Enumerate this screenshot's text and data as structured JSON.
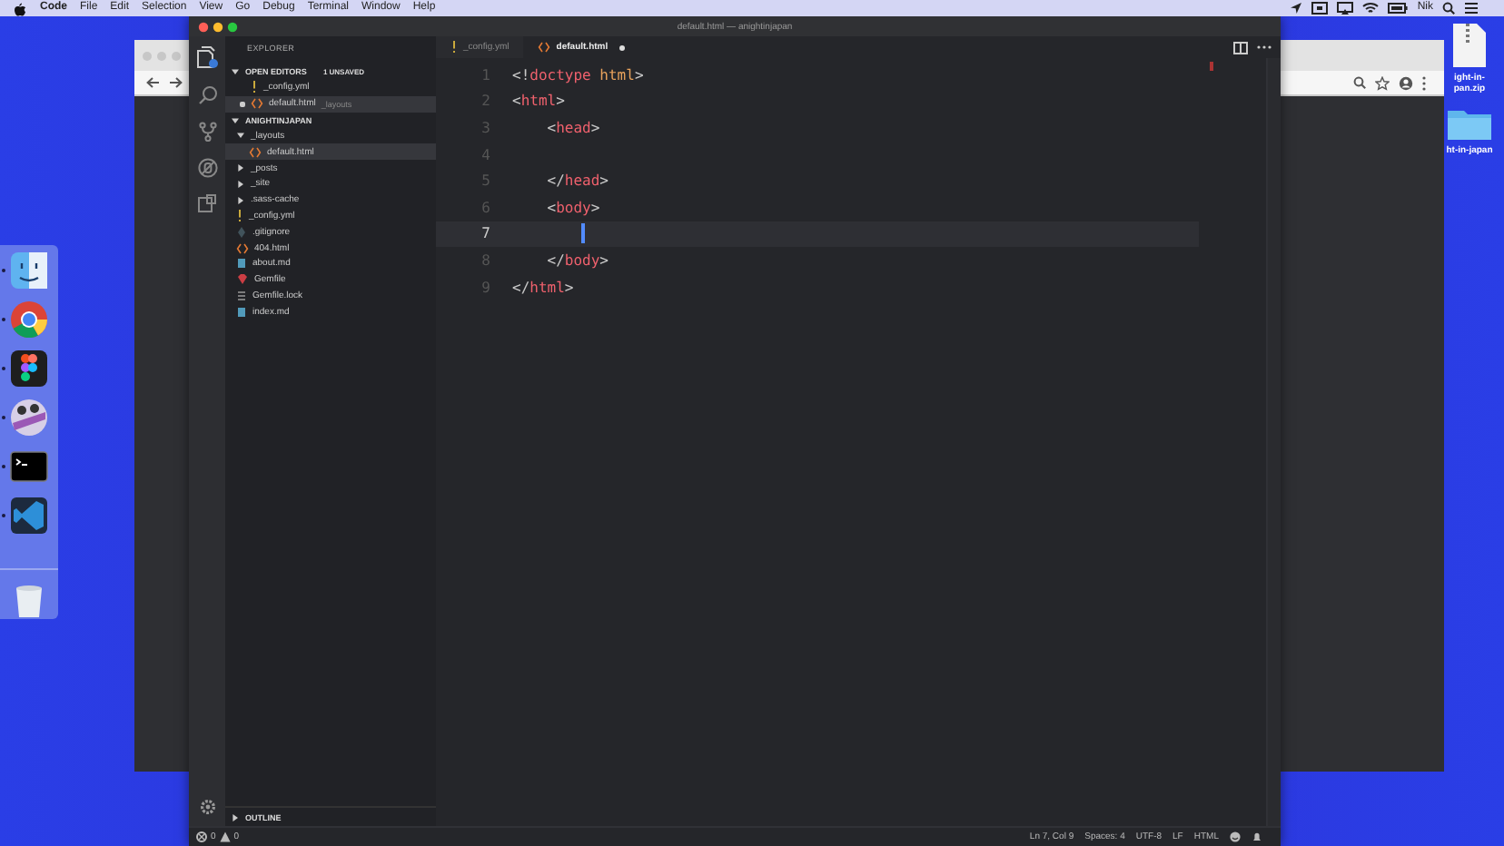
{
  "menubar": {
    "items": [
      {
        "label": "Code",
        "bold": true
      },
      {
        "label": "File",
        "bold": false
      },
      {
        "label": "Edit",
        "bold": false
      },
      {
        "label": "Selection",
        "bold": false
      },
      {
        "label": "View",
        "bold": false
      },
      {
        "label": "Go",
        "bold": false
      },
      {
        "label": "Debug",
        "bold": false
      },
      {
        "label": "Terminal",
        "bold": false
      },
      {
        "label": "Window",
        "bold": false
      },
      {
        "label": "Help",
        "bold": false
      }
    ],
    "user": "Nik"
  },
  "desktop_icons": [
    {
      "kind": "zip",
      "label_lines": [
        "ight-in-",
        "pan.zip"
      ]
    },
    {
      "kind": "folder",
      "label_lines": [
        "ht-in-japan"
      ]
    }
  ],
  "dock": [
    {
      "kind": "face",
      "running": true
    },
    {
      "kind": "browser",
      "running": true
    },
    {
      "kind": "shapes",
      "running": true
    },
    {
      "kind": "dots",
      "running": true
    },
    {
      "kind": "terminal",
      "running": true
    },
    {
      "kind": "ribbon",
      "running": true
    },
    {
      "kind": "trash",
      "running": false
    }
  ],
  "editor_window": {
    "title": "default.html — anightinjapan",
    "explorer": {
      "title": "EXPLORER",
      "open_editors": {
        "label": "OPEN EDITORS",
        "badge": "1 UNSAVED",
        "items": [
          {
            "name": "_config.yml",
            "kind": "yml",
            "dirty": false,
            "selected": false
          },
          {
            "name": "default.html",
            "detail": "_layouts",
            "kind": "html",
            "dirty": true,
            "selected": true
          }
        ]
      },
      "project": {
        "label": "ANIGHTINJAPAN",
        "items": [
          {
            "name": "_layouts",
            "kind": "folder",
            "expanded": true,
            "selected": false,
            "children": [
              {
                "name": "default.html",
                "kind": "html",
                "selected": true
              }
            ]
          },
          {
            "name": "_posts",
            "kind": "folder",
            "expanded": false,
            "selected": false
          },
          {
            "name": "_site",
            "kind": "folder",
            "expanded": false,
            "selected": false
          },
          {
            "name": ".sass-cache",
            "kind": "folder",
            "expanded": false,
            "selected": false
          },
          {
            "name": "_config.yml",
            "kind": "yml",
            "selected": false
          },
          {
            "name": ".gitignore",
            "kind": "git",
            "selected": false
          },
          {
            "name": "404.html",
            "kind": "html",
            "selected": false
          },
          {
            "name": "about.md",
            "kind": "md",
            "selected": false
          },
          {
            "name": "Gemfile",
            "kind": "gem",
            "selected": false
          },
          {
            "name": "Gemfile.lock",
            "kind": "lock",
            "selected": false
          },
          {
            "name": "index.md",
            "kind": "md",
            "selected": false
          }
        ]
      },
      "outline": {
        "label": "OUTLINE",
        "expanded": false
      }
    },
    "tabs": [
      {
        "label": "_config.yml",
        "kind": "yml",
        "selected": false,
        "dirty": false
      },
      {
        "label": "default.html",
        "kind": "html",
        "selected": true,
        "dirty": true
      }
    ],
    "lines": [
      {
        "number": "1",
        "current": false,
        "text": "<!doctype html>"
      },
      {
        "number": "2",
        "current": false,
        "text": "<html>"
      },
      {
        "number": "3",
        "current": false,
        "text": "    <head>"
      },
      {
        "number": "4",
        "current": false
      },
      {
        "number": "5",
        "current": false,
        "text": "    </head>"
      },
      {
        "number": "6",
        "current": false,
        "text": "    <body>"
      },
      {
        "number": "7",
        "current": true
      },
      {
        "number": "8",
        "current": false,
        "text": "    </body>"
      },
      {
        "number": "9",
        "current": false,
        "text": "</html>"
      }
    ],
    "status": {
      "errors": "0",
      "warnings": "0",
      "items": [
        "Ln 7, Col 9",
        "Spaces: 4",
        "UTF-8",
        "LF",
        "HTML"
      ]
    }
  }
}
